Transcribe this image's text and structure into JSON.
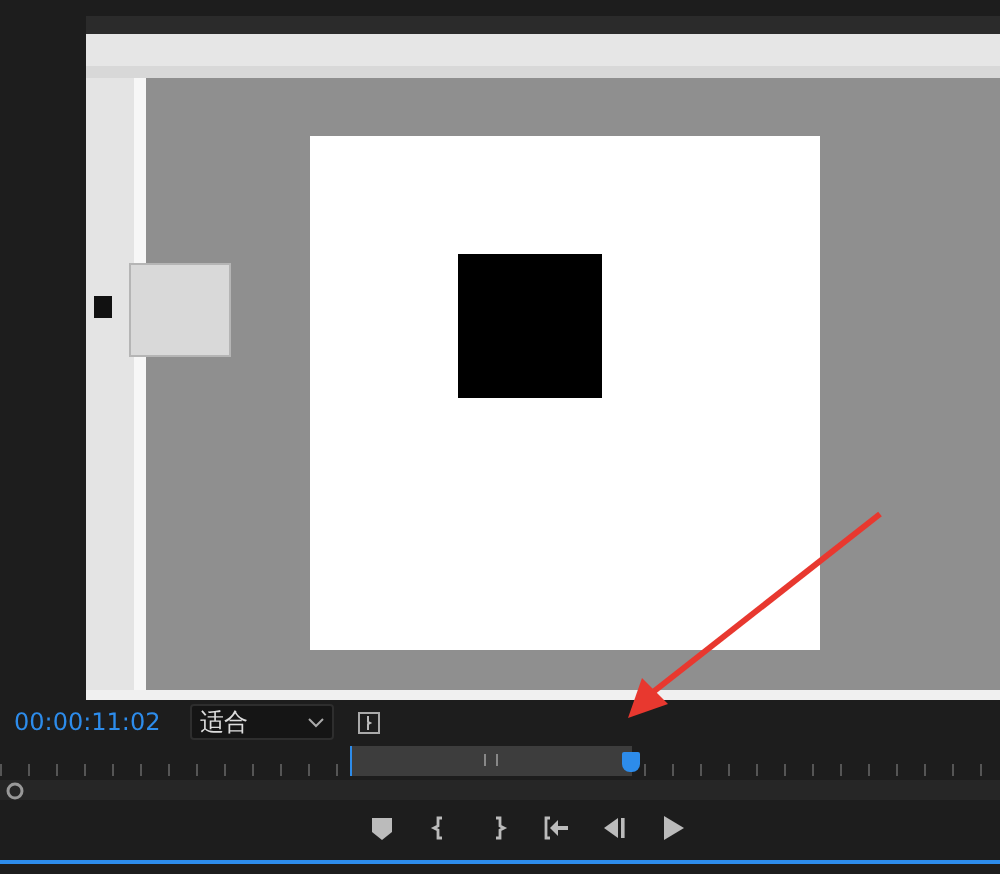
{
  "monitor": {
    "timecode": "00:00:11:02",
    "zoom_dropdown": {
      "value": "适合"
    }
  },
  "transport": [
    {
      "kind": "marker"
    },
    {
      "kind": "mark-in"
    },
    {
      "kind": "mark-out"
    },
    {
      "kind": "go-to-in"
    },
    {
      "kind": "step-back"
    },
    {
      "kind": "play"
    }
  ]
}
